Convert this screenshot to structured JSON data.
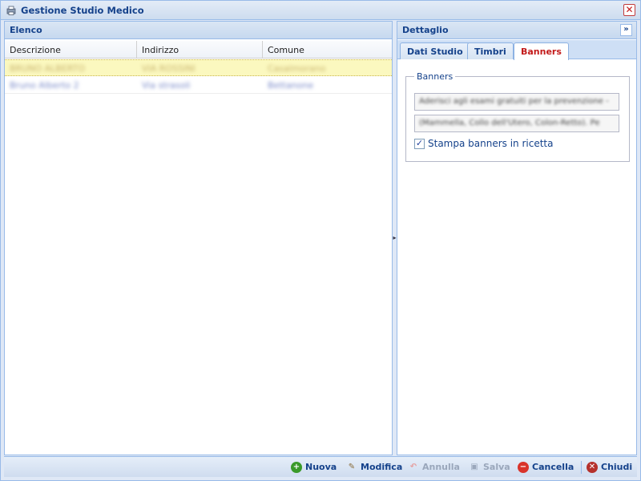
{
  "window": {
    "title": "Gestione Studio Medico",
    "close_glyph": "✕"
  },
  "left_panel": {
    "title": "Elenco",
    "columns": [
      "Descrizione",
      "Indirizzo",
      "Comune"
    ],
    "rows": [
      [
        "BRUNO ALBERTO",
        "VIA ROSSINI",
        "Casalmorano"
      ],
      [
        "Bruno Alberto 2",
        "Via strasoli",
        "Bettanone"
      ]
    ]
  },
  "right_panel": {
    "title": "Dettaglio",
    "collapse_glyph": "»",
    "tabs": [
      "Dati Studio",
      "Timbri",
      "Banners"
    ],
    "active_tab": 2,
    "banners": {
      "legend": "Banners",
      "field1": "Aderisci agli esami gratuiti per la prevenzione -",
      "field2": "(Mammella, Collo dell'Utero, Colon-Retto). Pe",
      "checkbox_label": "Stampa banners in ricetta",
      "checkbox_checked": true
    }
  },
  "toolbar": {
    "nuova": "Nuova",
    "modifica": "Modifica",
    "annulla": "Annulla",
    "salva": "Salva",
    "cancella": "Cancella",
    "chiudi": "Chiudi"
  },
  "colors": {
    "accent": "#15428b",
    "active_tab": "#c31b1b",
    "selected_row": "#fbf8bf",
    "add_icon": "#3a9a2a",
    "delete_icon": "#d9342b",
    "close_icon": "#b5312c"
  }
}
